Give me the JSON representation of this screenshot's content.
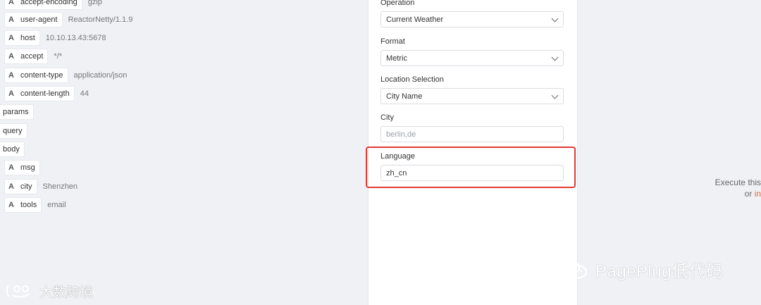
{
  "left": {
    "rows": [
      {
        "type": "A",
        "key": "accept-encoding",
        "value": "gzip"
      },
      {
        "type": "A",
        "key": "user-agent",
        "value": "ReactorNetty/1.1.9"
      },
      {
        "type": "A",
        "key": "host",
        "value": "10.10.13.43:5678"
      },
      {
        "type": "A",
        "key": "accept",
        "value": "*/*"
      },
      {
        "type": "A",
        "key": "content-type",
        "value": "application/json"
      },
      {
        "type": "A",
        "key": "content-length",
        "value": "44"
      }
    ],
    "groups": [
      "params",
      "query",
      "body"
    ],
    "body_rows": [
      {
        "type": "A",
        "key": "msg",
        "value": ""
      },
      {
        "type": "A",
        "key": "city",
        "value": "Shenzhen"
      },
      {
        "type": "A",
        "key": "tools",
        "value": "email"
      }
    ]
  },
  "form": {
    "operation_label": "Operation",
    "operation_value": "Current Weather",
    "format_label": "Format",
    "format_value": "Metric",
    "location_label": "Location Selection",
    "location_value": "City Name",
    "city_label": "City",
    "city_placeholder": "berlin,de",
    "language_label": "Language",
    "language_value": "zh_cn"
  },
  "right": {
    "line1": "Execute this",
    "line2_prefix": "or ",
    "line2_link": "in"
  },
  "watermarks": {
    "right": "PagePlug低代码",
    "left": "大数跨境"
  },
  "colors": {
    "highlight": "#e33b33",
    "link": "#e8622c"
  }
}
